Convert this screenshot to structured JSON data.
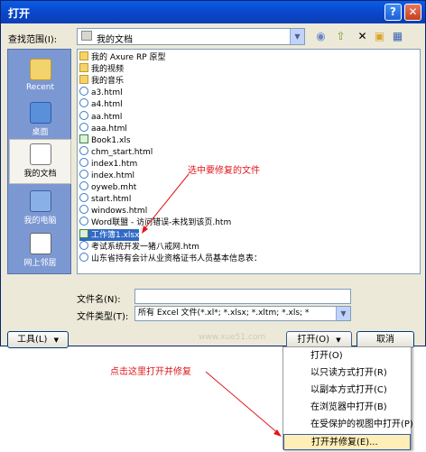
{
  "window": {
    "title": "打开",
    "help_label": "?",
    "close_label": "✕"
  },
  "lookin": {
    "label": "查找范围(I):",
    "value": "我的文档"
  },
  "toolbar_icons": [
    "back-icon",
    "up-folder-icon",
    "delete-icon",
    "new-folder-icon",
    "views-icon"
  ],
  "places": [
    {
      "label": "Recent",
      "icon": "recent-folder-icon"
    },
    {
      "label": "桌面",
      "icon": "desktop-icon"
    },
    {
      "label": "我的文档",
      "icon": "my-documents-icon"
    },
    {
      "label": "我的电脑",
      "icon": "my-computer-icon"
    },
    {
      "label": "网上邻居",
      "icon": "network-icon"
    }
  ],
  "files": [
    {
      "name": "我的 Axure RP 原型",
      "type": "folder"
    },
    {
      "name": "我的视频",
      "type": "folder"
    },
    {
      "name": "我的音乐",
      "type": "folder"
    },
    {
      "name": "a3.html",
      "type": "html"
    },
    {
      "name": "a4.html",
      "type": "html"
    },
    {
      "name": "aa.html",
      "type": "html"
    },
    {
      "name": "aaa.html",
      "type": "html"
    },
    {
      "name": "Book1.xls",
      "type": "xls"
    },
    {
      "name": "chm_start.html",
      "type": "html"
    },
    {
      "name": "index1.htm",
      "type": "html"
    },
    {
      "name": "index.html",
      "type": "html"
    },
    {
      "name": "oyweb.mht",
      "type": "html"
    },
    {
      "name": "start.html",
      "type": "html"
    },
    {
      "name": "windows.html",
      "type": "html"
    },
    {
      "name": "Word联盟 - 访问错误-未找到该页.htm",
      "type": "html"
    },
    {
      "name": "工作簿1.xlsx",
      "type": "xls",
      "selected": true
    },
    {
      "name": "考试系统开发一猪八戒网.htm",
      "type": "html"
    },
    {
      "name": "山东省持有会计从业资格证书人员基本信息表：",
      "type": "html"
    }
  ],
  "annotation_select": "选中要修复的文件",
  "filename": {
    "label": "文件名(N):",
    "value": ""
  },
  "filetype": {
    "label": "文件类型(T):",
    "value": "所有 Excel 文件(*.xl*; *.xlsx; *.xltm; *.xls; *"
  },
  "tools_label": "工具(L)",
  "open_label": "打开(O)",
  "cancel_label": "取消",
  "watermark": "www.xue51.com",
  "menu": [
    {
      "label": "打开(O)"
    },
    {
      "label": "以只读方式打开(R)"
    },
    {
      "label": "以副本方式打开(C)"
    },
    {
      "label": "在浏览器中打开(B)"
    },
    {
      "label": "在受保护的视图中打开(P)"
    },
    {
      "label": "打开并修复(E)...",
      "highlighted": true
    }
  ],
  "annotation_repair": "点击这里打开并修复",
  "colors": {
    "title_bar": "#0a46c8",
    "dialog_bg": "#ece9d8",
    "selection": "#316ac5",
    "annotation": "#e2161b",
    "menu_highlight": "#ffeeb5"
  }
}
